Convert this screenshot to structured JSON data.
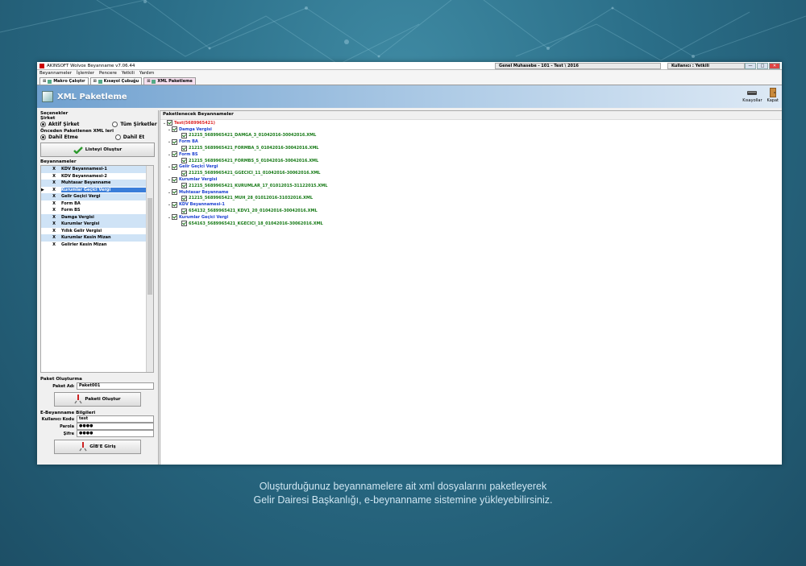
{
  "window": {
    "title": "AKINSOFT Wolvox Beyanname v7.06.44",
    "company_box": "Genel Muhasebe - 101 - Test \\ 2016",
    "user_box": "Kullanıcı : Yetkili",
    "min": "—",
    "max": "□",
    "close": "✕"
  },
  "menu": [
    "Beyannameler",
    "İşlemler",
    "Pencere",
    "Yetkili",
    "Yardım"
  ],
  "tabs": [
    "Makro Çalıştır",
    "Kısayol Çubuğu",
    "XML Paketleme"
  ],
  "banner": {
    "title": "XML Paketleme",
    "tool_shortcuts": "Kısayollar",
    "tool_close": "Kapat"
  },
  "left": {
    "options_title": "Seçenekler",
    "company_label": "Şirket",
    "active_company": "Aktif Şirket",
    "all_companies": "Tüm Şirketler",
    "prev_label": "Önceden Paketlenen XML leri",
    "exclude": "Dahil Etme",
    "include": "Dahil Et",
    "list_button": "Listeyi Oluştur",
    "decl_title": "Beyannameler",
    "declarations": [
      {
        "x": "X",
        "name": "KDV Beyannamesi-1"
      },
      {
        "x": "X",
        "name": "KDV Beyannamesi-2"
      },
      {
        "x": "X",
        "name": "Muhtasar Beyanname"
      },
      {
        "x": "X",
        "name": "Kurumlar Geçici Vergi"
      },
      {
        "x": "X",
        "name": "Gelir Geçici Vergi"
      },
      {
        "x": "X",
        "name": "Form BA"
      },
      {
        "x": "X",
        "name": "Form BS"
      },
      {
        "x": "X",
        "name": "Damga Vergisi"
      },
      {
        "x": "X",
        "name": "Kurumlar Vergisi"
      },
      {
        "x": "X",
        "name": "Yıllık Gelir Vergisi"
      },
      {
        "x": "X",
        "name": "Kurumlar Kesin Mizan"
      },
      {
        "x": "X",
        "name": "Gelirler Kesin Mizan"
      }
    ],
    "package_title": "Paket Oluşturma",
    "package_name_label": "Paket Adı",
    "package_name": "Paket001",
    "create_button": "Paketi Oluştur",
    "ebey_title": "E-Beyanname Bilgileri",
    "user_code_label": "Kullanıcı Kodu",
    "user_code": "test",
    "password_label": "Parola",
    "password": "●●●●",
    "secret_label": "Şifre",
    "secret": "●●●●",
    "gib_button": "GİB'E Giriş"
  },
  "right": {
    "title": "Paketlenecek Beyannameler",
    "root": "Test(5689965421)",
    "groups": [
      {
        "name": "Damga Vergisi",
        "file": "21215_5689965421_DAMGA_3_01042016-30042016.XML"
      },
      {
        "name": "Form BA",
        "file": "21215_5689965421_FORMBA_5_01042016-30042016.XML"
      },
      {
        "name": "Form BS",
        "file": "21215_5689965421_FORMBS_5_01042016-30042016.XML"
      },
      {
        "name": "Gelir Geçici Vergi",
        "file": "21215_5689965421_GGECICI_11_01042016-30062016.XML"
      },
      {
        "name": "Kurumlar Vergisi",
        "file": "21215_5689965421_KURUMLAR_17_01012015-31122015.XML"
      },
      {
        "name": "Muhtasar Beyanname",
        "file": "21215_5689965421_MUH_28_01012016-31032016.XML"
      },
      {
        "name": "KDV Beyannamesi-1",
        "file": "654132_5689965421_KDV1_20_01042016-30042016.XML"
      },
      {
        "name": "Kurumlar Geçici Vergi",
        "file": "654163_5689965421_KGECICI_18_01042016-30062016.XML"
      }
    ]
  },
  "caption": {
    "line1": "Oluşturduğunuz beyannamelere ait xml dosyalarını paketleyerek",
    "line2": "Gelir Dairesi Başkanlığı, e-beynanname sistemine yükleyebilirsiniz."
  }
}
